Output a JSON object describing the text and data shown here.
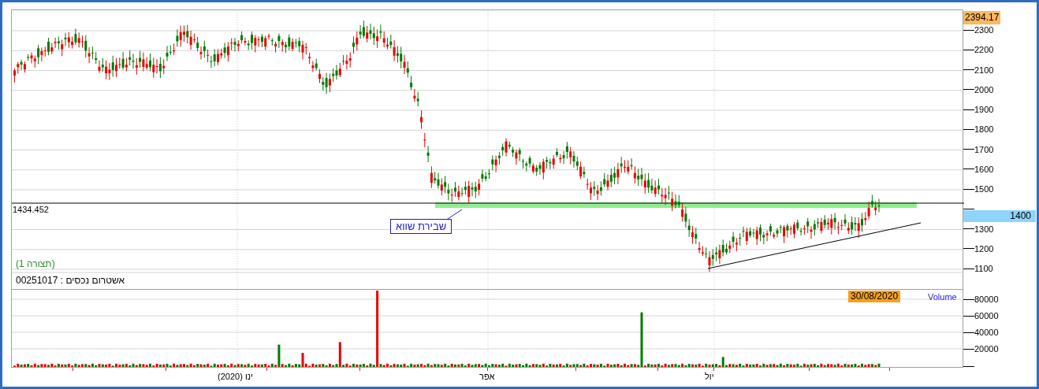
{
  "price_panel": {
    "last_price": "2394.17",
    "cursor_price": "1400",
    "level_line_label": "1434.452",
    "annotation": "שבירת שווא",
    "pattern_label": "(תצורה 1)",
    "instrument": "אשטרום נכסים : 00251017",
    "y_ticks": [
      "2300",
      "2200",
      "2100",
      "2000",
      "1900",
      "1800",
      "1700",
      "1600",
      "1500",
      "1300",
      "1200",
      "1100"
    ]
  },
  "volume_panel": {
    "date": "30/08/2020",
    "title": "Volume",
    "y_ticks": [
      "80000",
      "60000",
      "40000",
      "20000"
    ]
  },
  "x_axis": {
    "labels": [
      "יול",
      "אפר",
      "ינו (2020)"
    ]
  }
}
